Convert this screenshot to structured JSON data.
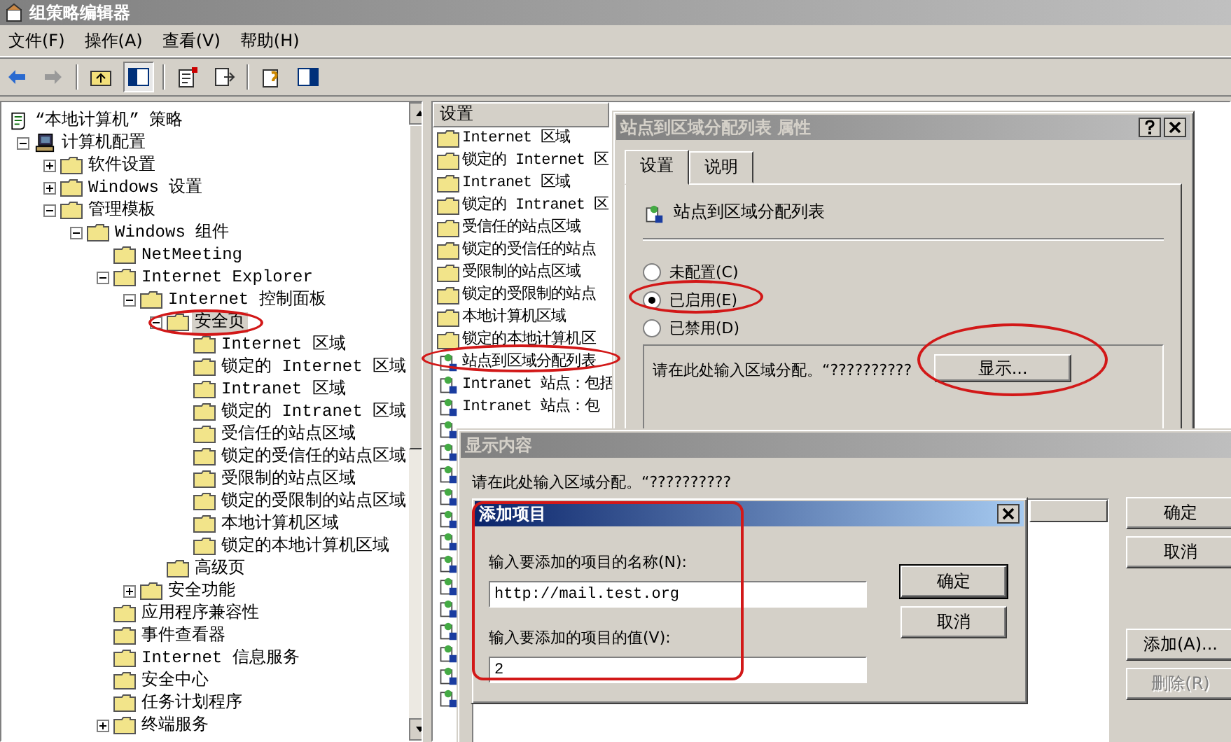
{
  "window": {
    "title": "组策略编辑器",
    "active": false
  },
  "menu": [
    "文件(F)",
    "操作(A)",
    "查看(V)",
    "帮助(H)"
  ],
  "tree": {
    "items": [
      {
        "label": "“本地计算机” 策略",
        "kind": "root",
        "selected": false,
        "children": [
          {
            "label": "计算机配置",
            "kind": "computer",
            "expanded": true,
            "selected": false,
            "children": [
              {
                "label": "软件设置",
                "kind": "folder",
                "expanded": false,
                "selected": false
              },
              {
                "label": "Windows 设置",
                "kind": "folder",
                "expanded": false,
                "selected": false
              },
              {
                "label": "管理模板",
                "kind": "folder",
                "expanded": true,
                "selected": false,
                "children": [
                  {
                    "label": "Windows 组件",
                    "kind": "folder",
                    "expanded": true,
                    "selected": false,
                    "children": [
                      {
                        "label": "NetMeeting",
                        "kind": "folder",
                        "selected": false
                      },
                      {
                        "label": "Internet Explorer",
                        "kind": "folder",
                        "expanded": true,
                        "selected": false,
                        "children": [
                          {
                            "label": "Internet 控制面板",
                            "kind": "folder",
                            "expanded": true,
                            "selected": false,
                            "children": [
                              {
                                "label": "安全页",
                                "kind": "folder",
                                "expanded": true,
                                "selected": true,
                                "children": [
                                  {
                                    "label": "Internet 区域",
                                    "kind": "folder",
                                    "selected": false
                                  },
                                  {
                                    "label": "锁定的 Internet 区域",
                                    "kind": "folder",
                                    "selected": false
                                  },
                                  {
                                    "label": "Intranet 区域",
                                    "kind": "folder",
                                    "selected": false
                                  },
                                  {
                                    "label": "锁定的 Intranet 区域",
                                    "kind": "folder",
                                    "selected": false
                                  },
                                  {
                                    "label": "受信任的站点区域",
                                    "kind": "folder",
                                    "selected": false
                                  },
                                  {
                                    "label": "锁定的受信任的站点区域",
                                    "kind": "folder",
                                    "selected": false
                                  },
                                  {
                                    "label": "受限制的站点区域",
                                    "kind": "folder",
                                    "selected": false
                                  },
                                  {
                                    "label": "锁定的受限制的站点区域",
                                    "kind": "folder",
                                    "selected": false
                                  },
                                  {
                                    "label": "本地计算机区域",
                                    "kind": "folder",
                                    "selected": false
                                  },
                                  {
                                    "label": "锁定的本地计算机区域",
                                    "kind": "folder",
                                    "selected": false
                                  }
                                ]
                              },
                              {
                                "label": "高级页",
                                "kind": "folder",
                                "selected": false
                              }
                            ]
                          },
                          {
                            "label": "安全功能",
                            "kind": "folder",
                            "expanded": false,
                            "selected": false
                          }
                        ]
                      },
                      {
                        "label": "应用程序兼容性",
                        "kind": "folder",
                        "selected": false
                      },
                      {
                        "label": "事件查看器",
                        "kind": "folder",
                        "selected": false
                      },
                      {
                        "label": "Internet 信息服务",
                        "kind": "folder",
                        "selected": false
                      },
                      {
                        "label": "安全中心",
                        "kind": "folder",
                        "selected": false
                      },
                      {
                        "label": "任务计划程序",
                        "kind": "folder",
                        "selected": false
                      },
                      {
                        "label": "终端服务",
                        "kind": "folder",
                        "expanded": false,
                        "selected": false
                      }
                    ]
                  }
                ]
              }
            ]
          }
        ]
      }
    ]
  },
  "settings_list": {
    "header": "设置",
    "items": [
      {
        "label": "Internet 区域",
        "kind": "folder"
      },
      {
        "label": "锁定的 Internet 区",
        "kind": "folder"
      },
      {
        "label": "Intranet 区域",
        "kind": "folder"
      },
      {
        "label": "锁定的 Intranet 区",
        "kind": "folder"
      },
      {
        "label": "受信任的站点区域",
        "kind": "folder"
      },
      {
        "label": "锁定的受信任的站点",
        "kind": "folder"
      },
      {
        "label": "受限制的站点区域",
        "kind": "folder"
      },
      {
        "label": "锁定的受限制的站点",
        "kind": "folder"
      },
      {
        "label": "本地计算机区域",
        "kind": "folder"
      },
      {
        "label": "锁定的本地计算机区",
        "kind": "folder"
      },
      {
        "label": "站点到区域分配列表",
        "kind": "policy"
      },
      {
        "label": "Intranet 站点：包括",
        "kind": "policy"
      },
      {
        "label": "Intranet 站点：包",
        "kind": "policy"
      }
    ]
  },
  "properties": {
    "title": "站点到区域分配列表 属性",
    "active": false,
    "tabs": [
      {
        "label": "设置",
        "selected": true
      },
      {
        "label": "说明",
        "selected": false
      }
    ],
    "setting_name": "站点到区域分配列表",
    "options": [
      {
        "label": "未配置(C)",
        "selected": false
      },
      {
        "label": "已启用(E)",
        "selected": true
      },
      {
        "label": "已禁用(D)",
        "selected": false
      }
    ],
    "option_text": "请在此处输入区域分配。“??????????",
    "show_button": "显示..."
  },
  "show_contents": {
    "title": "显示内容",
    "active": false,
    "prompt": "请在此处输入区域分配。“??????????",
    "buttons": [
      {
        "label": "确定",
        "disabled": false
      },
      {
        "label": "取消",
        "disabled": false
      },
      {
        "label": "添加(A)...",
        "disabled": false
      },
      {
        "label": "删除(R)",
        "disabled": true
      }
    ]
  },
  "add_item": {
    "title": "添加项目",
    "active": true,
    "fields": [
      {
        "label": "输入要添加的项目的名称(N):",
        "value": "http://mail.test.org"
      },
      {
        "label": "输入要添加的项目的值(V):",
        "value": "2"
      }
    ],
    "buttons": [
      {
        "label": "确定",
        "default": true
      },
      {
        "label": "取消",
        "default": false
      }
    ]
  }
}
